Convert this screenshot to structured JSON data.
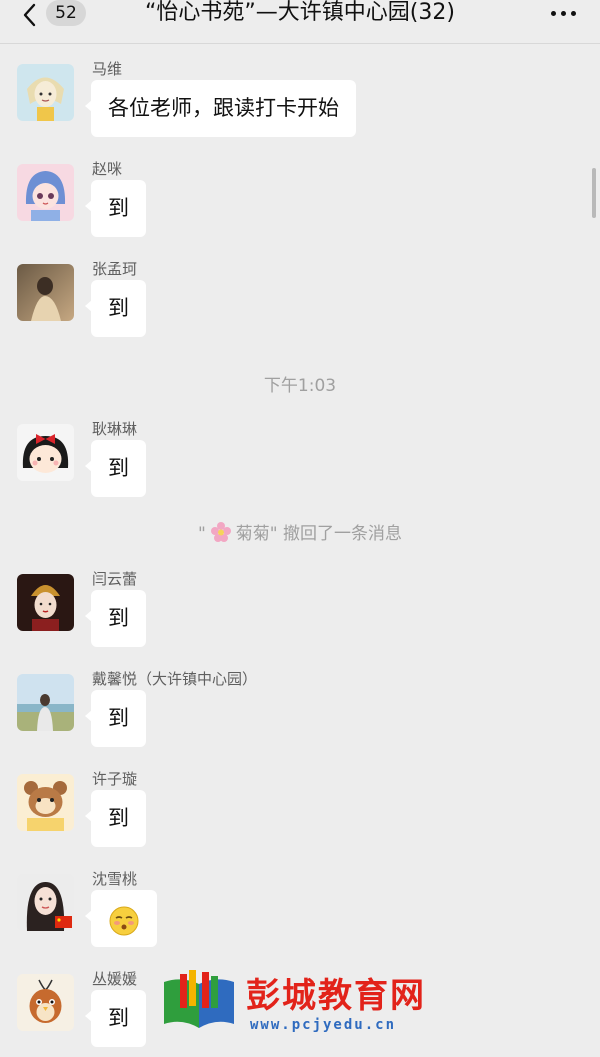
{
  "header": {
    "unread_count": "52",
    "title": "“怡心书苑”—大许镇中心园(32)"
  },
  "messages": [
    {
      "sender": "马维",
      "text": "各位老师，跟读打卡开始",
      "avatar": "cartoon-girl-avatar"
    },
    {
      "sender": "赵咪",
      "text": "到",
      "avatar": "anime-girl-blue-hood-avatar"
    },
    {
      "sender": "张孟珂",
      "text": "到",
      "avatar": "photo-person-avatar"
    },
    {
      "sender": "耿琳琳",
      "text": "到",
      "avatar": "cartoon-girl-bow-avatar"
    },
    {
      "sender": "闫云蕾",
      "text": "到",
      "avatar": "costume-portrait-avatar"
    },
    {
      "sender": "戴馨悦（大许镇中心园）",
      "text": "到",
      "avatar": "beach-photo-avatar"
    },
    {
      "sender": "许子璇",
      "text": "到",
      "avatar": "cartoon-bear-avatar"
    },
    {
      "sender": "沈雪桃",
      "text": "",
      "avatar": "girl-portrait-flag-avatar",
      "emoji": "blush-face-emoji"
    },
    {
      "sender": "丛媛媛",
      "text": "到",
      "avatar": "cartoon-bird-avatar"
    }
  ],
  "time_divider": "下午1:03",
  "system_note": {
    "prefix": "\"",
    "name": "菊菊",
    "suffix": "\" 撤回了一条消息"
  },
  "watermark": {
    "title": "彭城教育网",
    "url": "www.pcjyedu.cn"
  },
  "colors": {
    "background": "#ededed",
    "bubble": "#ffffff",
    "watermark_red": "#e2231a",
    "watermark_blue": "#2f6bbf"
  }
}
